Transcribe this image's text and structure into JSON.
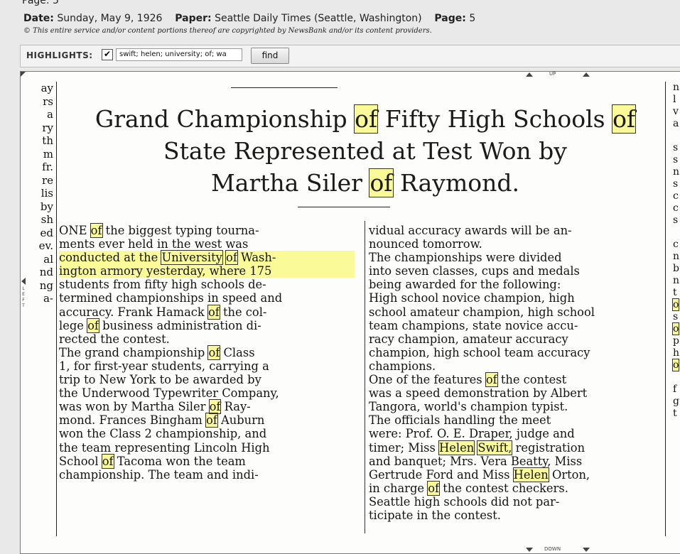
{
  "page_title": "Page: 5",
  "meta": {
    "date_label": "Date:",
    "date_value": "Sunday, May 9, 1926",
    "paper_label": "Paper:",
    "paper_value": "Seattle Daily Times (Seattle, Washington)",
    "page_label": "Page:",
    "page_value": "5",
    "copyright": "© This entire service and/or content portions thereof are copyrighted by NewsBank and/or its content providers."
  },
  "highlights": {
    "label": "HIGHLIGHTS:",
    "checked": true,
    "check_mark": "✔",
    "query": "swift; helen; university; of; wa",
    "find_label": "find"
  },
  "viewer_nav": {
    "up": "UP",
    "down": "DOWN",
    "left": "LEFT"
  },
  "article": {
    "headline_1a": "Grand Championship ",
    "headline_1b": "of",
    "headline_1c": " Fifty High Schools ",
    "headline_1d": "of",
    "headline_2": "State Represented at Test Won by",
    "headline_3a": "Martha Siler ",
    "headline_3b": "of",
    "headline_3c": " Raymond."
  },
  "left_margin_fragments": [
    "ay",
    "rs",
    "a",
    "ry",
    "th",
    "m",
    "fr.",
    "re",
    "lis",
    "by",
    "sh",
    "",
    "ed",
    "ev.",
    "al",
    "nd",
    "",
    "",
    "ng",
    "a-"
  ],
  "right_margin_fragments": [
    "n",
    "l",
    "v",
    "a",
    "",
    "s",
    "s",
    "n",
    "s",
    "c",
    "c",
    "s",
    "",
    "c",
    "n",
    "b",
    "n",
    "t",
    "o",
    "s",
    "o",
    "p",
    "h",
    "o",
    "",
    "f",
    "g",
    "t"
  ]
}
